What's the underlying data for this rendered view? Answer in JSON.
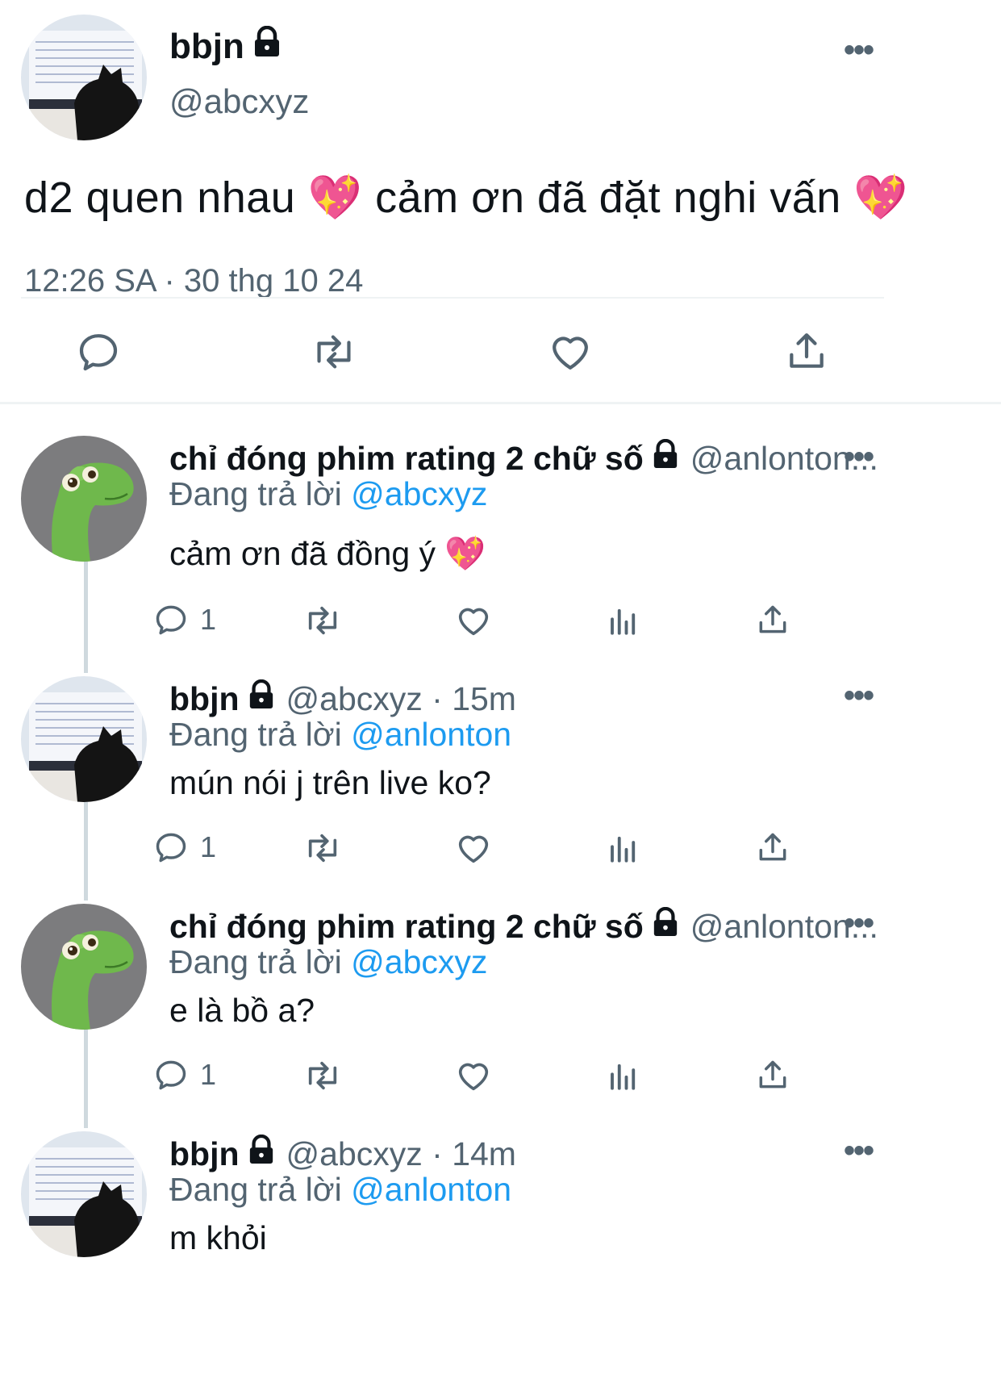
{
  "main_tweet": {
    "display_name": "bbjn",
    "handle": "@abcxyz",
    "text": "d2 quen nhau 💖  cảm ơn đã đặt nghi vấn 💖",
    "timestamp": "12:26 SA · 30 thg 10 24",
    "actions": [
      "reply-icon",
      "retweet-icon",
      "like-icon",
      "share-icon"
    ]
  },
  "replies": [
    {
      "display_name": "chỉ đóng phim rating 2 chữ số",
      "handle_meta": "@anlonton...",
      "replying_prefix": "Đang trả lời",
      "replying_to": "@abcxyz",
      "text": "cảm ơn đã đồng ý 💖",
      "reply_count": "1",
      "avatar": "dinosaur"
    },
    {
      "display_name": "bbjn",
      "handle_meta": "@abcxyz · 15m",
      "replying_prefix": "Đang trả lời",
      "replying_to": "@anlonton",
      "text": "mún nói j trên live ko?",
      "reply_count": "1",
      "avatar": "cat"
    },
    {
      "display_name": "chỉ đóng phim rating 2 chữ số",
      "handle_meta": "@anlonton...",
      "replying_prefix": "Đang trả lời",
      "replying_to": "@abcxyz",
      "text": "e là bồ a?",
      "reply_count": "1",
      "avatar": "dinosaur"
    },
    {
      "display_name": "bbjn",
      "handle_meta": "@abcxyz · 14m",
      "replying_prefix": "Đang trả lời",
      "replying_to": "@anlonton",
      "text": "m khỏi",
      "avatar": "cat"
    }
  ],
  "colors": {
    "accent": "#1d9bf0",
    "secondary_text": "#536471",
    "divider": "#eff3f4",
    "thread_line": "#cfd9de"
  }
}
